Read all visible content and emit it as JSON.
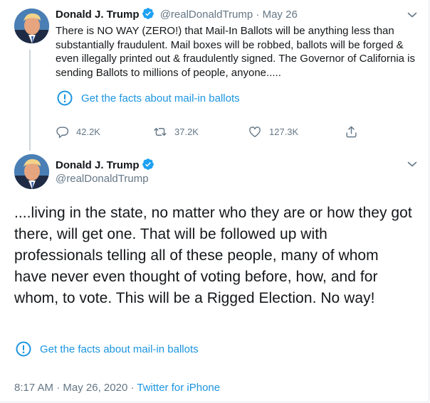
{
  "tweet1": {
    "author_name": "Donald J. Trump",
    "handle": "@realDonaldTrump",
    "separator": "·",
    "date": "May 26",
    "text": "There is NO WAY (ZERO!) that Mail-In Ballots will be anything less than substantially fraudulent. Mail boxes will be robbed, ballots will be forged & even illegally printed out & fraudulently signed. The Governor of California is sending Ballots to millions of people, anyone.....",
    "fact_check_label": "Get the facts about mail-in ballots",
    "actions": {
      "replies": "42.2K",
      "retweets": "37.2K",
      "likes": "127.3K"
    }
  },
  "tweet2": {
    "author_name": "Donald J. Trump",
    "handle": "@realDonaldTrump",
    "text": "....living in the state, no matter who they are or how they got there, will get one. That will be followed up with professionals telling all of these people, many of whom have never even thought of voting before, how, and for whom, to vote. This will be a Rigged Election. No way!",
    "fact_check_label": "Get the facts about mail-in ballots",
    "time": "8:17 AM",
    "date": "May 26, 2020",
    "separator": "·",
    "source": "Twitter for iPhone"
  },
  "colors": {
    "link": "#1b95e0",
    "muted": "#657786",
    "text": "#14171a",
    "verified": "#1da1f2"
  }
}
